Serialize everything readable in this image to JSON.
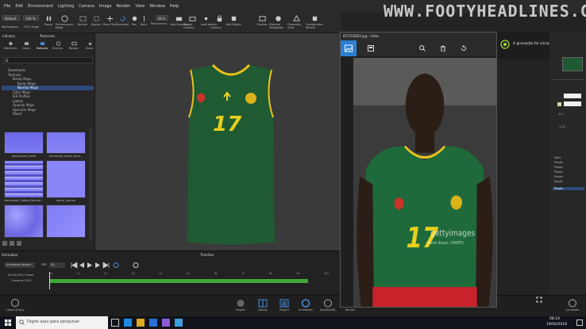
{
  "menu": [
    "File",
    "Edit",
    "Environment",
    "Lighting",
    "Camera",
    "Image",
    "Render",
    "View",
    "Window",
    "Help"
  ],
  "toolbar": {
    "view_select": "Default",
    "zoom_value": "100 %",
    "workspaces_label": "Workspaces",
    "cpu_usage_label": "CPU Usage",
    "fov_value": "60.0",
    "items": [
      "Pause",
      "Performance Mode",
      "Region",
      "Move Tool",
      "Turntable",
      "Pan",
      "Dolly",
      "Perspective",
      "Add Camera",
      "Lock Camera",
      "Add Studio",
      "Studios",
      "Material Templates",
      "Geometry View",
      "Configurator Wizard"
    ],
    "small_items": [
      "Render",
      "Snapshot",
      "Toggle Camera",
      "Lock Camera",
      "Look at",
      "Reset Camera"
    ]
  },
  "library": {
    "title": "Library",
    "header": "Textures",
    "tabs": [
      "Materials",
      "Colors",
      "Textures",
      "Environ.",
      "Backpl.",
      "Favor."
    ],
    "tree": [
      "Downloads",
      "Textures",
      "Bump Maps",
      "Bump Maps",
      "Normal Maps",
      "Color Maps",
      "IES Profiles",
      "Labels",
      "Opacity Maps",
      "Specular Maps",
      "Wood"
    ],
    "thumbs": [
      {
        "label": "galvanized_metal"
      },
      {
        "label": "horizontal_wave_norm..."
      },
      {
        "label": "Horizontal_Cables_Normal..."
      },
      {
        "label": "stone_normal"
      },
      {
        "label": ""
      },
      {
        "label": ""
      }
    ]
  },
  "viewport": {
    "section_label": "Timeline"
  },
  "timeline": {
    "title": "Animation",
    "animation_label": "Animation Wizard",
    "fps_label": "FPS",
    "fps_value": "30",
    "time_label": "00:00:000 | Frame",
    "layer_label": "Cameras 2011",
    "ticks": [
      "0s",
      "1s",
      "2s",
      "3s",
      "4s",
      "5s",
      "6s",
      "7s",
      "8s",
      "9s",
      "10s"
    ]
  },
  "bottom": {
    "cloud_label": "Cloud Library",
    "items": [
      "Import",
      "Library",
      "Project",
      "Animation",
      "KeyShotXR",
      "Render"
    ],
    "right_label": "Lanzeider"
  },
  "photos": {
    "titlebar": "651702852.jpg - Fotos",
    "image_watermark_1": "gettyimages",
    "image_watermark_2": "Robin Stuart / SPORTS"
  },
  "toast": {
    "text": "A gravação foi iniciada"
  },
  "right_panel": {
    "values": [
      "0.1",
      "1.11"
    ],
    "list": [
      "Spec",
      "Plastic",
      "Plastic",
      "Plastic",
      "Plastic",
      "Plastic",
      "Plastic"
    ]
  },
  "taskbar": {
    "search_placeholder": "Digite aqui para pesquisar",
    "time": "08:14",
    "date": "19/04/2018"
  },
  "watermark": "WWW.FOOTYHEADLINES.COM",
  "colors": {
    "accent": "#3a6fc4",
    "timeline_green": "#3fa83a",
    "jersey": "#1f5a32"
  }
}
